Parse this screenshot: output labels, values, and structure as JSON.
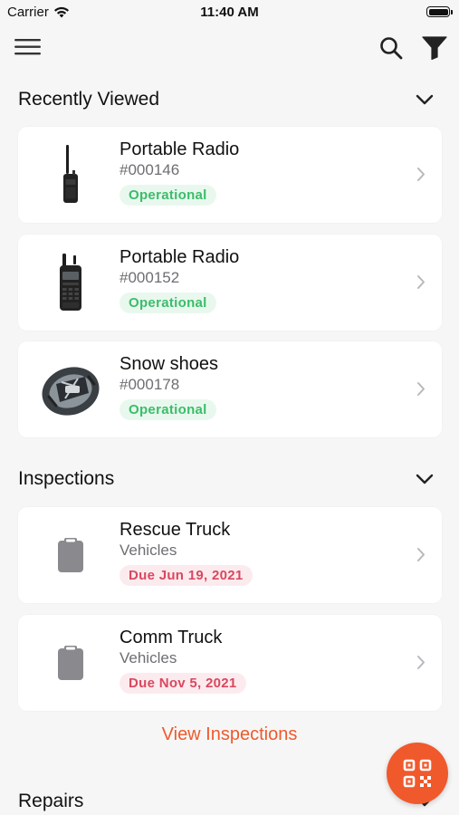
{
  "status_bar": {
    "carrier": "Carrier",
    "time": "11:40 AM",
    "battery_level": 1.0
  },
  "nav": {
    "menu_icon": "hamburger-menu-icon",
    "search_icon": "search-icon",
    "filter_icon": "filter-icon"
  },
  "recently_viewed": {
    "title": "Recently Viewed",
    "items": [
      {
        "name": "Portable Radio",
        "id": "#000146",
        "status": "Operational",
        "thumb": "portable-radio-thin"
      },
      {
        "name": "Portable Radio",
        "id": "#000152",
        "status": "Operational",
        "thumb": "portable-radio-keypad"
      },
      {
        "name": "Snow shoes",
        "id": "#000178",
        "status": "Operational",
        "thumb": "snow-shoe"
      }
    ]
  },
  "inspections": {
    "title": "Inspections",
    "items": [
      {
        "name": "Rescue Truck",
        "category": "Vehicles",
        "due": "Due Jun 19, 2021",
        "thumb": "clipboard-icon"
      },
      {
        "name": "Comm Truck",
        "category": "Vehicles",
        "due": "Due Nov 5, 2021",
        "thumb": "clipboard-icon"
      }
    ],
    "view_link": "View Inspections"
  },
  "repairs": {
    "title": "Repairs"
  },
  "colors": {
    "accent": "#f0592c",
    "link": "#ee5a2c",
    "operational_text": "#3bbd6a",
    "operational_bg": "#e9f8ee",
    "due_text": "#d9485f",
    "due_bg": "#fcebee",
    "background": "#f6f6f6"
  },
  "fab": {
    "icon": "qr-code-icon"
  }
}
